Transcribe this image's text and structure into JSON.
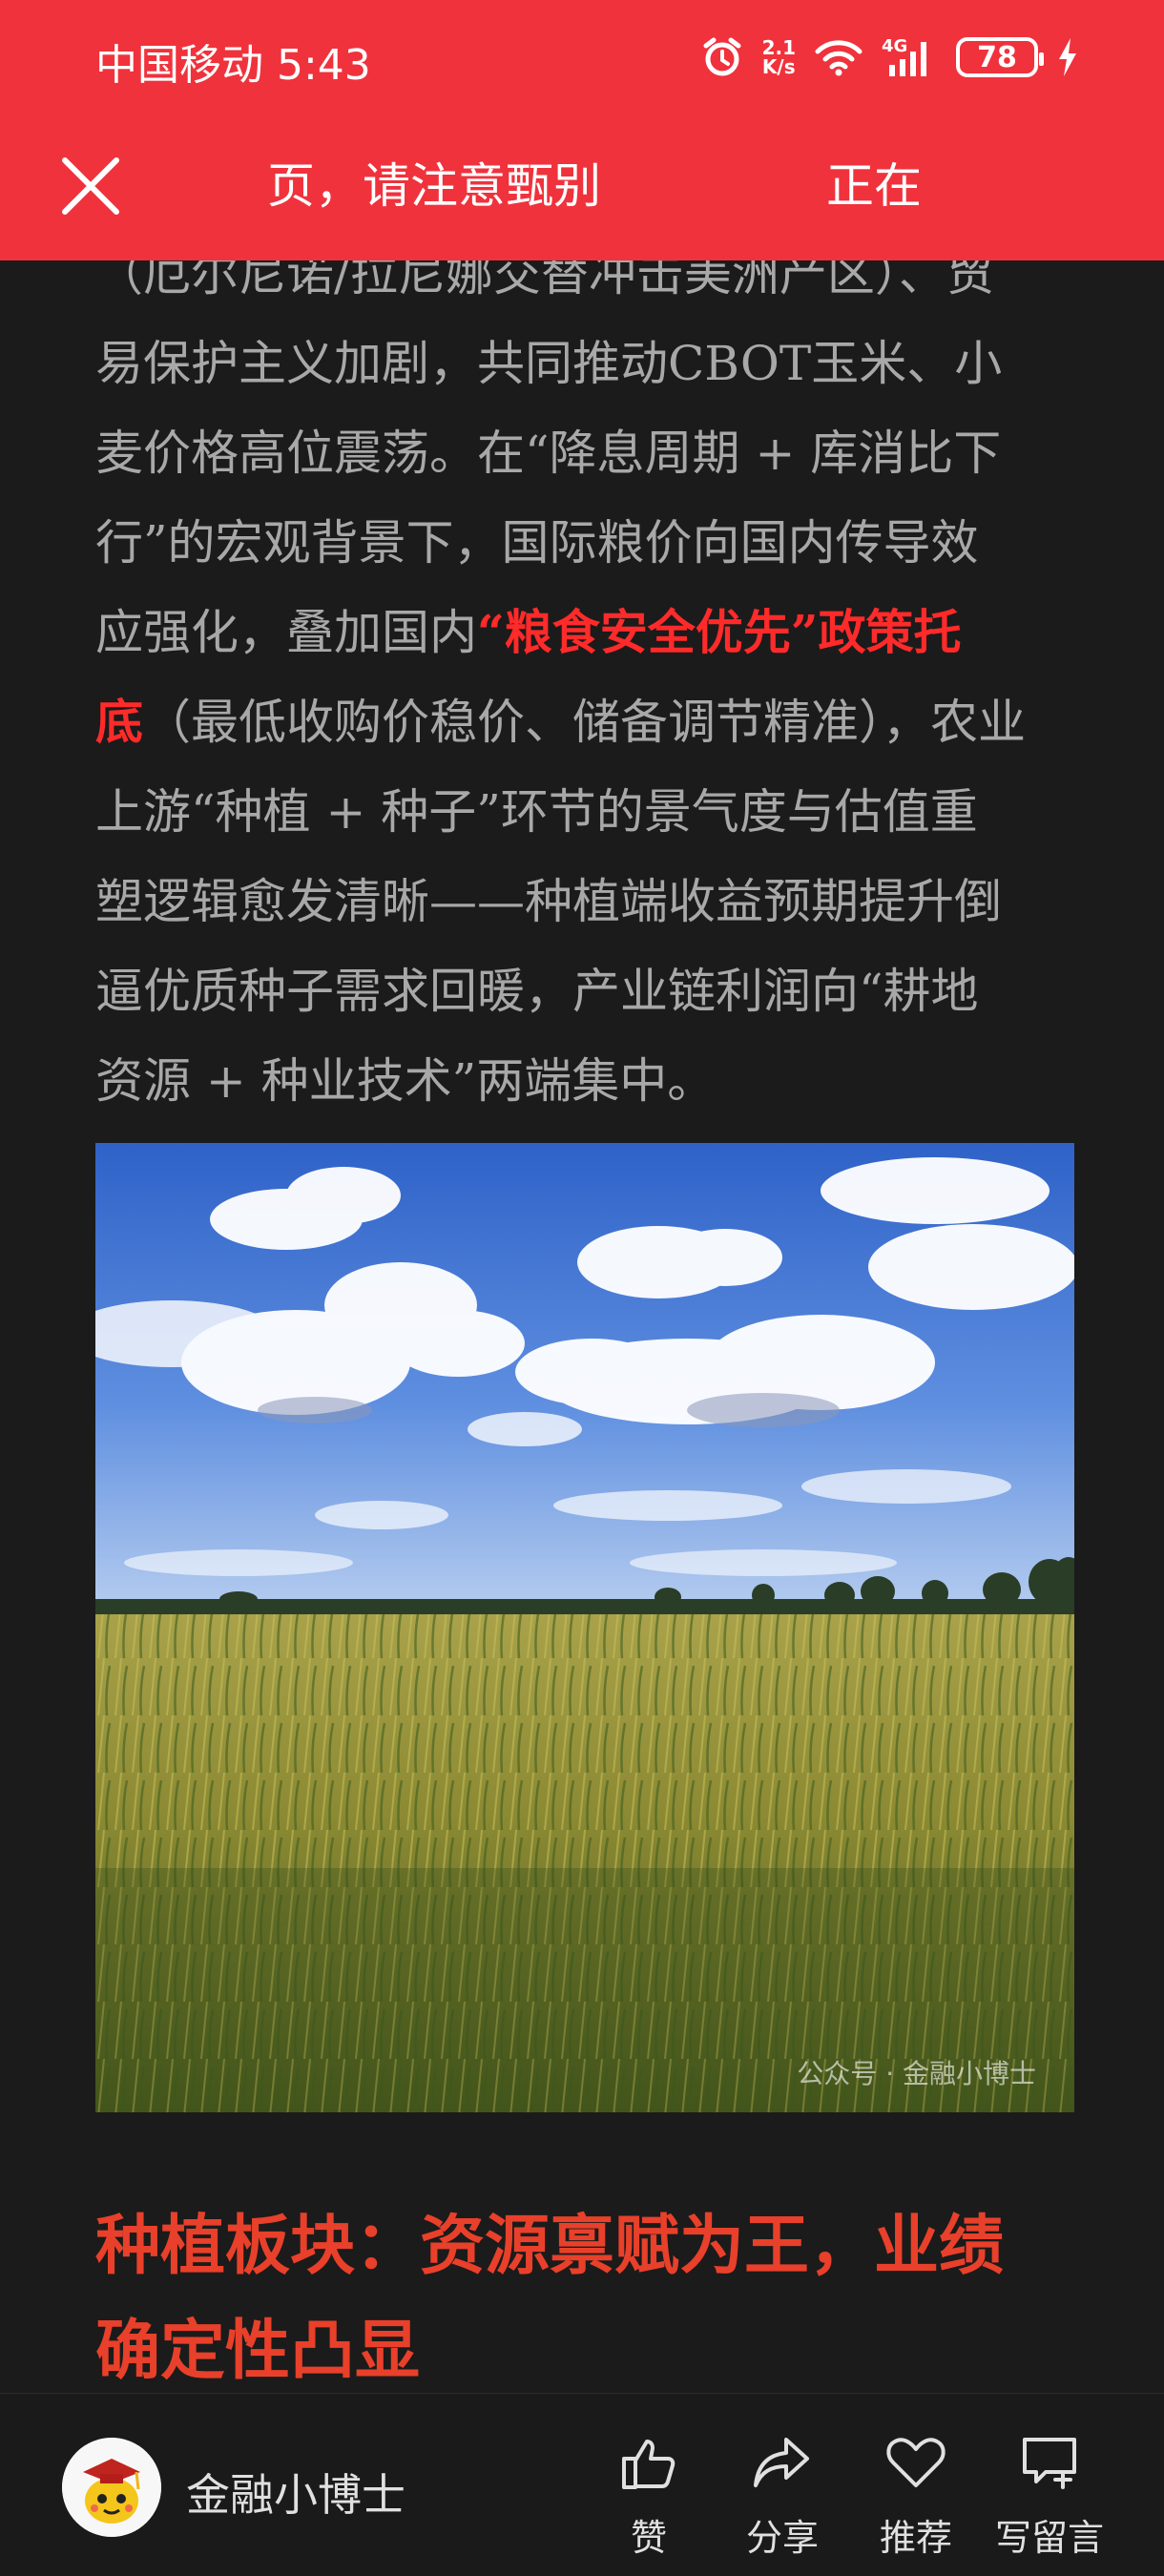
{
  "status_bar": {
    "carrier_time": "中国移动 5:43",
    "speed_value": "2.1",
    "speed_unit": "K/s",
    "network": "4G",
    "battery": "78"
  },
  "nav": {
    "marquee_text_1": "页，请注意甄别",
    "marquee_text_2": "正在"
  },
  "article": {
    "line0": "（厄尔尼诺/拉尼娜交替冲击美洲产区）、贸",
    "line1": "易保护主义加剧，共同推动CBOT玉米、小",
    "line2": "麦价格高位震荡。在“降息周期 + 库消比下",
    "line3": "行”的宏观背景下，国际粮价向国内传导效",
    "line4_pre": "应强化，叠加国内",
    "line4_hl": "“粮食安全优先”政策托",
    "line5_hl": "底",
    "line5_post": "（最低收购价稳价、储备调节精准），农业",
    "line6": "上游“种植 + 种子”环节的景气度与估值重",
    "line7": "塑逻辑愈发清晰——种植端收益预期提升倒",
    "line8": "逼优质种子需求回暖，产业链利润向“耕地",
    "line9": "资源 + 种业技术”两端集中。"
  },
  "image": {
    "watermark": "公众号 · 金融小博士"
  },
  "section": {
    "title_line1": "种植板块：资源禀赋为王，业绩",
    "title_line2": "确定性凸显"
  },
  "bottom": {
    "author": "金融小博士",
    "like": "赞",
    "share": "分享",
    "recommend": "推荐",
    "comment": "写留言"
  },
  "colors": {
    "header_red": "#f0323c",
    "highlight_red": "#ff2a2a",
    "section_red": "#e8402a",
    "background": "#1b1b1b"
  }
}
